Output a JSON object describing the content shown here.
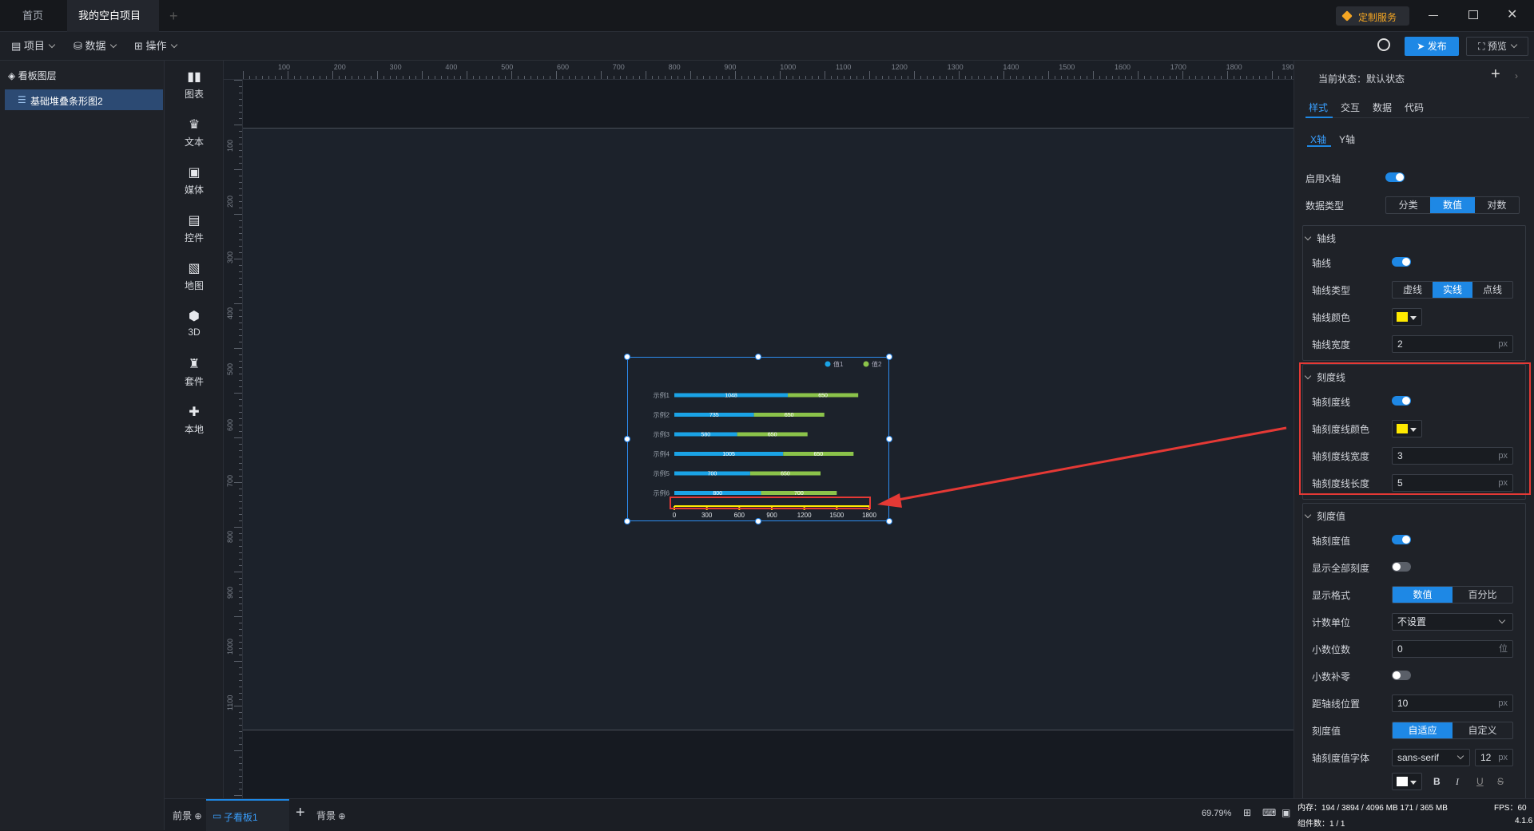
{
  "tabs": {
    "home": "首页",
    "project": "我的空白项目",
    "custom": "定制服务"
  },
  "toolbar": {
    "project": "项目",
    "data": "数据",
    "ops": "操作",
    "publish": "发布",
    "preview": "预览"
  },
  "layers": {
    "title": "看板图层",
    "item": "基础堆叠条形图2"
  },
  "rail": [
    "图表",
    "文本",
    "媒体",
    "控件",
    "地图",
    "3D",
    "套件",
    "本地"
  ],
  "ruler_top": [
    "100",
    "200",
    "300",
    "400",
    "500",
    "600",
    "700",
    "800",
    "900",
    "1000",
    "1100",
    "1200",
    "1300",
    "1400",
    "1500",
    "1600",
    "1700",
    "1800",
    "1900"
  ],
  "ruler_left": [
    "100",
    "200",
    "300",
    "400",
    "500",
    "600",
    "700",
    "800",
    "900",
    "1000",
    "1100"
  ],
  "chart_data": {
    "type": "bar",
    "orientation": "horizontal",
    "stacked": true,
    "categories": [
      "示例1",
      "示例2",
      "示例3",
      "示例4",
      "示例5",
      "示例6"
    ],
    "series": [
      {
        "name": "值1",
        "values": [
          1048,
          735,
          580,
          1005,
          700,
          800
        ],
        "color": "#1aa3e6"
      },
      {
        "name": "值2",
        "values": [
          650,
          650,
          650,
          650,
          650,
          700
        ],
        "color": "#8bc34a"
      }
    ],
    "xticks": [
      "0",
      "300",
      "600",
      "900",
      "1200",
      "1500",
      "1800"
    ],
    "xlim": [
      0,
      1800
    ],
    "axis_color": "#ffea00",
    "legend": "top-right"
  },
  "panel": {
    "state_label": "当前状态：",
    "state_value": "默认状态",
    "tabs": [
      "样式",
      "交互",
      "数据",
      "代码"
    ],
    "axis_tabs": [
      "X轴",
      "Y轴"
    ],
    "enable_x": "启用X轴",
    "data_type": "数据类型",
    "data_type_opts": [
      "分类",
      "数值",
      "对数"
    ],
    "axis_line": "轴线",
    "axis_line_on": "轴线",
    "line_type": "轴线类型",
    "line_type_opts": [
      "虚线",
      "实线",
      "点线"
    ],
    "line_color": "轴线颜色",
    "line_width": "轴线宽度",
    "line_width_val": "2",
    "tick": "刻度线",
    "tick_on": "轴刻度线",
    "tick_color": "轴刻度线颜色",
    "tick_width": "轴刻度线宽度",
    "tick_width_val": "3",
    "tick_len": "轴刻度线长度",
    "tick_len_val": "5",
    "tick_val": "刻度值",
    "tick_val_on": "轴刻度值",
    "show_all": "显示全部刻度",
    "fmt": "显示格式",
    "fmt_opts": [
      "数值",
      "百分比"
    ],
    "unit": "计数单位",
    "unit_val": "不设置",
    "decimals": "小数位数",
    "decimals_val": "0",
    "decimals_unit": "位",
    "pad_zero": "小数补零",
    "offset": "距轴线位置",
    "offset_val": "10",
    "tickv": "刻度值",
    "tickv_opts": [
      "自适应",
      "自定义"
    ],
    "font": "轴刻度值字体",
    "font_val": "sans-serif",
    "font_size": "12",
    "px": "px"
  },
  "bottom": {
    "front": "前景",
    "sub": "子看板1",
    "back": "背景",
    "zoom": "69.79%",
    "mem_label": "内存：",
    "mem_val": "194 / 3894 / 4096 MB  171 / 365 MB",
    "fps_label": "FPS：",
    "fps_val": "60",
    "count_label": "组件数：",
    "count_val": "1 / 1",
    "version": "4.1.6"
  }
}
